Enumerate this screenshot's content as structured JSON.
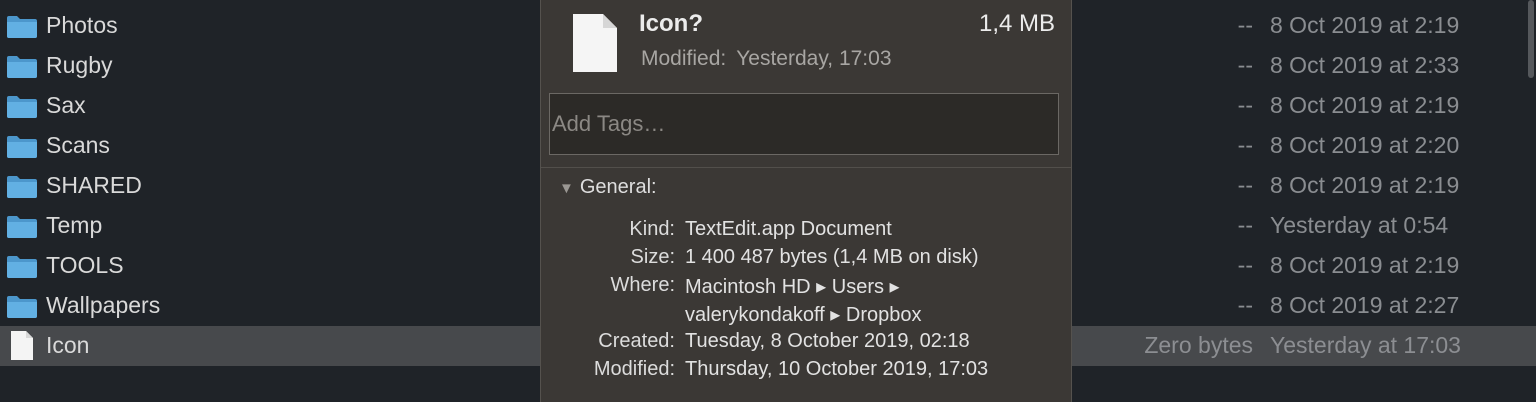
{
  "finder": {
    "rows": [
      {
        "name": "Photos",
        "size": "--",
        "date": "8 Oct 2019 at 2:19",
        "kind": "folder"
      },
      {
        "name": "Rugby",
        "size": "--",
        "date": "8 Oct 2019 at 2:33",
        "kind": "folder"
      },
      {
        "name": "Sax",
        "size": "--",
        "date": "8 Oct 2019 at 2:19",
        "kind": "folder"
      },
      {
        "name": "Scans",
        "size": "--",
        "date": "8 Oct 2019 at 2:20",
        "kind": "folder"
      },
      {
        "name": "SHARED",
        "size": "--",
        "date": "8 Oct 2019 at 2:19",
        "kind": "folder"
      },
      {
        "name": "Temp",
        "size": "--",
        "date": "Yesterday at 0:54",
        "kind": "folder"
      },
      {
        "name": "TOOLS",
        "size": "--",
        "date": "8 Oct 2019 at 2:19",
        "kind": "folder"
      },
      {
        "name": "Wallpapers",
        "size": "--",
        "date": "8 Oct 2019 at 2:27",
        "kind": "folder"
      },
      {
        "name": "Icon",
        "size": "Zero bytes",
        "date": "Yesterday at 17:03",
        "kind": "file",
        "selected": true
      }
    ],
    "folder_color": "#5aa9dc"
  },
  "info": {
    "title": "Icon?",
    "size": "1,4 MB",
    "modified_label": "Modified:",
    "modified_value": "Yesterday, 17:03",
    "tags_placeholder": "Add Tags…",
    "general_label": "General:",
    "properties": [
      {
        "key": "Kind:",
        "value": "TextEdit.app Document"
      },
      {
        "key": "Size:",
        "value": "1 400 487 bytes (1,4 MB on disk)"
      },
      {
        "key": "Where:",
        "value": "Macintosh HD ▸ Users ▸"
      },
      {
        "key": "",
        "value": "valerykondakoff ▸ Dropbox"
      },
      {
        "key": "Created:",
        "value": "Tuesday, 8 October 2019, 02:18"
      },
      {
        "key": "Modified:",
        "value": "Thursday, 10 October 2019, 17:03"
      }
    ]
  }
}
